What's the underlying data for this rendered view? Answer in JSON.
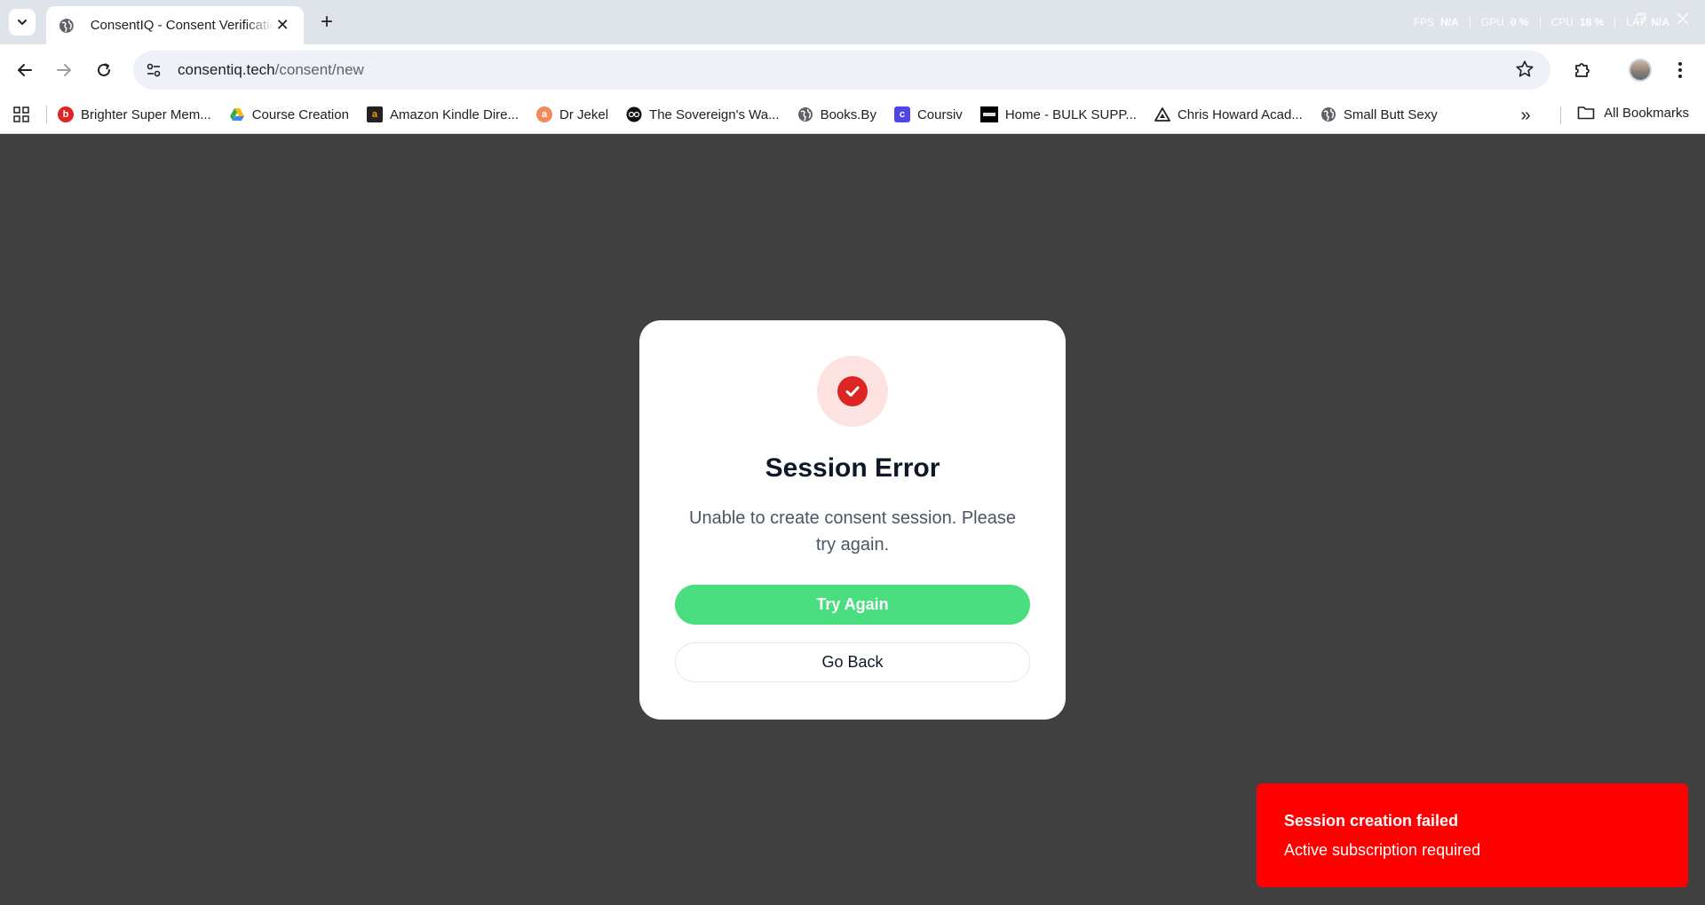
{
  "browser": {
    "tab": {
      "title": "ConsentIQ - Consent Verification",
      "close": "✕"
    },
    "new_tab": "+",
    "perf": [
      {
        "label": "FPS",
        "value": "N/A"
      },
      {
        "label": "GPU",
        "value": "0 %"
      },
      {
        "label": "CPU",
        "value": "18 %"
      },
      {
        "label": "LAT",
        "value": "N/A"
      }
    ],
    "url": {
      "host": "consentiq.tech",
      "path": "/consent/new"
    },
    "bookmarks": [
      {
        "label": "Brighter Super Mem...",
        "color": "#e02424",
        "glyph": "b"
      },
      {
        "label": "Course Creation",
        "color": "#1a73e8",
        "glyph": ""
      },
      {
        "label": "Amazon Kindle Dire...",
        "color": "#222222",
        "glyph": "a"
      },
      {
        "label": "Dr Jekel",
        "color": "#f28b5b",
        "glyph": "a"
      },
      {
        "label": "The Sovereign's Wa...",
        "color": "#111111",
        "glyph": ""
      },
      {
        "label": "Books.By",
        "color": "#5f6368",
        "glyph": ""
      },
      {
        "label": "Coursiv",
        "color": "#4f46e5",
        "glyph": "c"
      },
      {
        "label": "Home - BULK SUPP...",
        "color": "#000000",
        "glyph": ""
      },
      {
        "label": "Chris Howard Acad...",
        "color": "#ffffff",
        "glyph": ""
      },
      {
        "label": "Small Butt Sexy",
        "color": "#5f6368",
        "glyph": ""
      }
    ],
    "more_bookmarks": "»",
    "all_bookmarks": "All Bookmarks"
  },
  "dialog": {
    "title": "Session Error",
    "message": "Unable to create consent session. Please try again.",
    "primary_label": "Try Again",
    "secondary_label": "Go Back"
  },
  "toast": {
    "title": "Session creation failed",
    "description": "Active subscription required"
  },
  "colors": {
    "backdrop": "#404040",
    "primary_button": "#4ade80",
    "error": "#dc2626",
    "toast": "#ff0000"
  }
}
